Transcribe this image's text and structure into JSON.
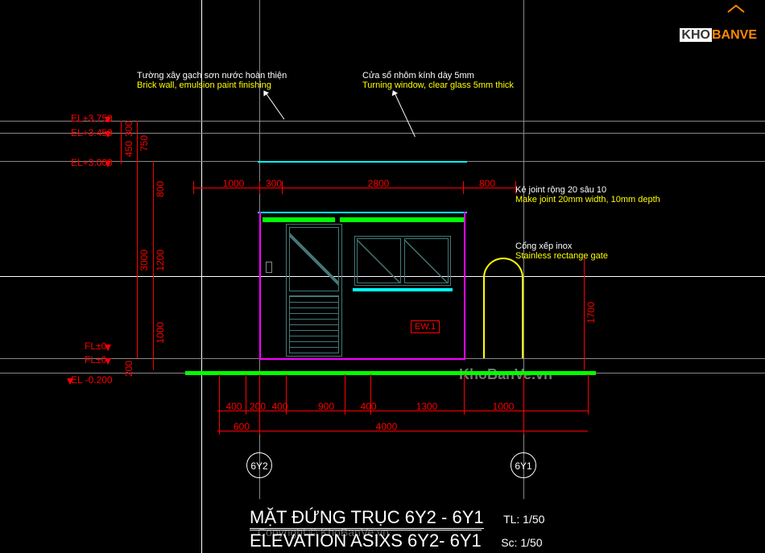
{
  "logo": {
    "brand_a": "KHO",
    "brand_b": "BANVE"
  },
  "watermarks": {
    "center": "KhoBanVe.vn",
    "copyright": "Copyright © KhoBanVe.vn"
  },
  "annotations": {
    "wall": {
      "vn": "Tường xây gạch sơn nước hoàn thiện",
      "en": "Brick wall, emulsion paint finishing"
    },
    "window_note": {
      "vn": "Cửa sổ nhôm kính dày 5mm",
      "en": "Turning window, clear glass 5mm thick"
    },
    "joint": {
      "vn": "Kẻ joint rộng 20 sâu 10",
      "en": "Make joint 20mm width, 10mm depth"
    },
    "gate": {
      "vn": "Cổng xếp inox",
      "en": "Stainless rectange gate"
    }
  },
  "levels": {
    "el_3750": "EL+3.750",
    "el_3450": "EL+3.450",
    "el_3000": "EL+3.000",
    "fl_0a": "FL±0",
    "fl_0b": "FL±0",
    "el_m200": "EL -0.200"
  },
  "dims_v": {
    "d300": "300",
    "d450": "450",
    "d750": "750",
    "d800": "800",
    "d1200": "1200",
    "d1000": "1000",
    "d200": "200",
    "d3000": "3000",
    "d1700": "1700"
  },
  "dims_h_top": {
    "d1000": "1000",
    "d300": "300",
    "d2800": "2800",
    "d800": "800"
  },
  "dims_h_bot1": {
    "d400a": "400",
    "d200": "200",
    "d400b": "400",
    "d900": "900",
    "d400c": "400",
    "d1300": "1300",
    "d1000": "1000"
  },
  "dims_h_bot2": {
    "d600": "600",
    "d4000": "4000"
  },
  "axes": {
    "a1": "6Y2",
    "a2": "6Y1"
  },
  "ew_tag": "EW.1",
  "title": {
    "vn": "MẶT ĐỨNG TRỤC 6Y2 - 6Y1",
    "scale_vn": "TL: 1/50",
    "en": "ELEVATION ASIXS 6Y2- 6Y1",
    "scale_en": "Sc: 1/50"
  }
}
